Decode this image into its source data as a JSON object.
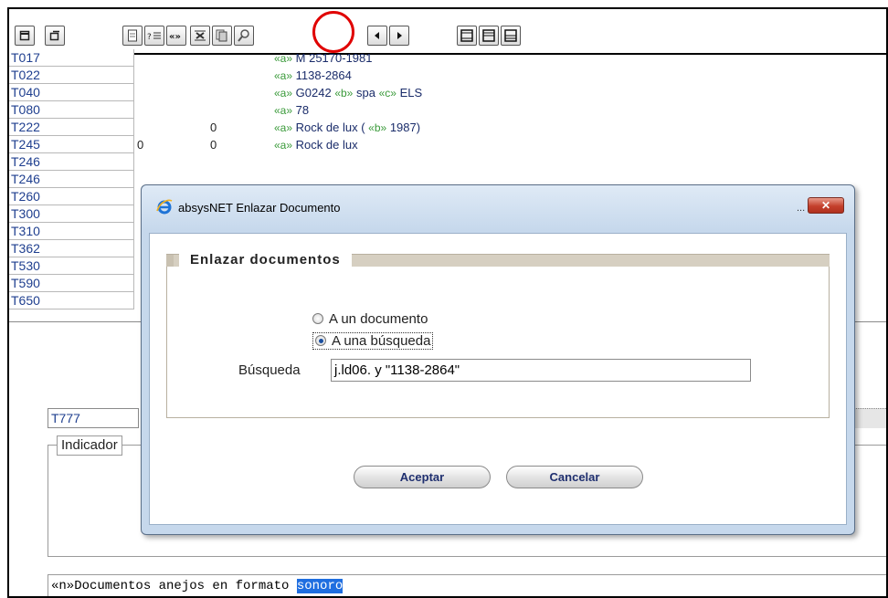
{
  "grid": {
    "rows": [
      {
        "tag": "T017",
        "ind1": "",
        "ind2": "",
        "sub1": "«a»",
        "text1": "M 25170-1981",
        "sub2": "",
        "text2": "",
        "sub3": "",
        "text3": ""
      },
      {
        "tag": "T022",
        "ind1": "",
        "ind2": "",
        "sub1": "«a»",
        "text1": "1138-2864",
        "sub2": "",
        "text2": "",
        "sub3": "",
        "text3": ""
      },
      {
        "tag": "T040",
        "ind1": "",
        "ind2": "",
        "sub1": "«a»",
        "text1": "G0242",
        "sub2": "«b»",
        "text2": "spa",
        "sub3": "«c»",
        "text3": "ELS"
      },
      {
        "tag": "T080",
        "ind1": "",
        "ind2": "",
        "sub1": "«a»",
        "text1": "78",
        "sub2": "",
        "text2": "",
        "sub3": "",
        "text3": ""
      },
      {
        "tag": "T222",
        "ind1": "",
        "ind2": "0",
        "sub1": "«a»",
        "text1": "Rock de lux (",
        "sub2": "«b»",
        "text2": "1987)",
        "sub3": "",
        "text3": ""
      },
      {
        "tag": "T245",
        "ind1": "0",
        "ind2": "0",
        "sub1": "«a»",
        "text1": "Rock de lux",
        "sub2": "",
        "text2": "",
        "sub3": "",
        "text3": ""
      },
      {
        "tag": "T246",
        "ind1": "",
        "ind2": "",
        "sub1": "",
        "text1": "",
        "sub2": "",
        "text2": "",
        "sub3": "",
        "text3": ""
      },
      {
        "tag": "T246",
        "ind1": "",
        "ind2": "",
        "sub1": "",
        "text1": "",
        "sub2": "",
        "text2": "",
        "sub3": "",
        "text3": ""
      },
      {
        "tag": "T260",
        "ind1": "",
        "ind2": "",
        "sub1": "",
        "text1": "",
        "sub2": "",
        "text2": "",
        "sub3": "",
        "text3": ""
      },
      {
        "tag": "T300",
        "ind1": "",
        "ind2": "",
        "sub1": "",
        "text1": "",
        "sub2": "",
        "text2": "",
        "sub3": "",
        "text3": ""
      },
      {
        "tag": "T310",
        "ind1": "",
        "ind2": "",
        "sub1": "",
        "text1": "",
        "sub2": "",
        "text2": "",
        "sub3": "",
        "text3": ""
      },
      {
        "tag": "T362",
        "ind1": "",
        "ind2": "",
        "sub1": "",
        "text1": "",
        "sub2": "",
        "text2": "",
        "sub3": "",
        "text3": ""
      },
      {
        "tag": "T530",
        "ind1": "",
        "ind2": "",
        "sub1": "",
        "text1": "",
        "sub2": "",
        "text2": "",
        "sub3": "",
        "text3": ""
      },
      {
        "tag": "T590",
        "ind1": "",
        "ind2": "",
        "sub1": "",
        "text1": "",
        "sub2": "",
        "text2": "",
        "sub3": "",
        "text3": ""
      },
      {
        "tag": "T650",
        "ind1": "",
        "ind2": "",
        "sub1": "",
        "text1": "",
        "sub2": "",
        "text2": "",
        "sub3": "",
        "text3": ""
      }
    ]
  },
  "editor": {
    "field_tag": "T777",
    "indicators_legend": "Indicador",
    "text_prefix": "«n»Documentos anejos en formato ",
    "text_selected": "sonoro"
  },
  "dialog": {
    "title": "absysNET Enlazar Documento",
    "dots": "...",
    "close_glyph": "✕",
    "panel_title": "Enlazar documentos",
    "option_document": "A un documento",
    "option_search": "A una búsqueda",
    "selected_option": "search",
    "search_label": "Búsqueda",
    "search_value": "j.ld06. y \"1138-2864\"",
    "accept_label": "Aceptar",
    "cancel_label": "Cancelar"
  },
  "colors": {
    "tag_text": "#1f3f8f",
    "subfield": "#3a9a3a",
    "dialog_frame": "#c6d8ec",
    "highlight": "#e00000",
    "selection": "#1f6ee0"
  },
  "icons": {
    "toolbar": [
      "window-icon",
      "window-icon",
      "document-icon",
      "list-icon",
      "link-icon",
      "delete-field-icon",
      "copy-document-icon",
      "search-icon",
      "link-document-icon",
      "arrow-left-icon",
      "arrow-right-icon",
      "layout-full-icon",
      "layout-split-icon",
      "layout-horizontal-icon"
    ]
  }
}
